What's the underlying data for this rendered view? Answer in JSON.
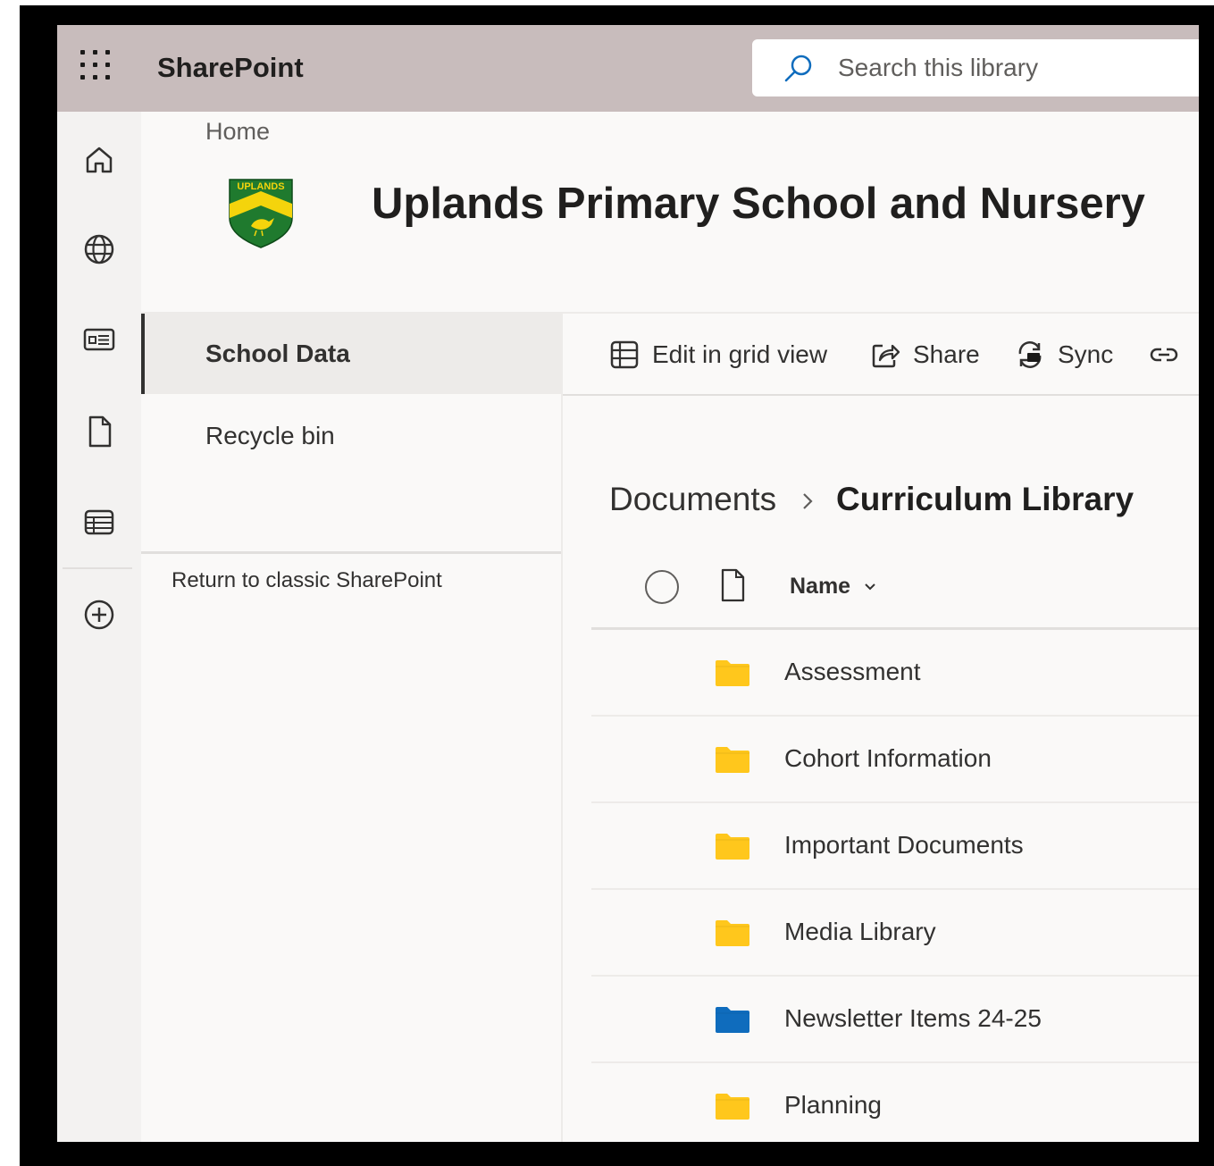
{
  "suite_bar": {
    "app_name": "SharePoint",
    "search_placeholder": "Search this library"
  },
  "site_header": {
    "home_link": "Home",
    "logo_text": "UPLANDS",
    "title": "Uplands Primary School and Nursery"
  },
  "app_rail": {
    "icons": [
      "home-icon",
      "globe-icon",
      "news-icon",
      "document-icon",
      "list-icon",
      "add-circle-icon"
    ]
  },
  "left_nav": {
    "items": [
      {
        "label": "School Data",
        "selected": true
      },
      {
        "label": "Recycle bin",
        "selected": false
      }
    ],
    "classic_link": "Return to classic SharePoint"
  },
  "command_bar": {
    "edit_grid": "Edit in grid view",
    "share": "Share",
    "sync": "Sync"
  },
  "breadcrumb": {
    "root": "Documents",
    "current": "Curriculum Library"
  },
  "list": {
    "name_column": "Name",
    "rows": [
      {
        "name": "Assessment",
        "folder_color": "#ffc71c"
      },
      {
        "name": "Cohort Information",
        "folder_color": "#ffc71c"
      },
      {
        "name": "Important Documents",
        "folder_color": "#ffc71c"
      },
      {
        "name": "Media Library",
        "folder_color": "#ffc71c"
      },
      {
        "name": "Newsletter Items 24-25",
        "folder_color": "#0f6cbd"
      },
      {
        "name": "Planning",
        "folder_color": "#ffc71c"
      }
    ]
  },
  "colors": {
    "suite_bar_bg": "#c8bcbc",
    "folder_yellow": "#ffc71c",
    "folder_blue": "#0f6cbd",
    "logo_green": "#1f7a2e",
    "logo_yellow": "#f4d40c"
  }
}
